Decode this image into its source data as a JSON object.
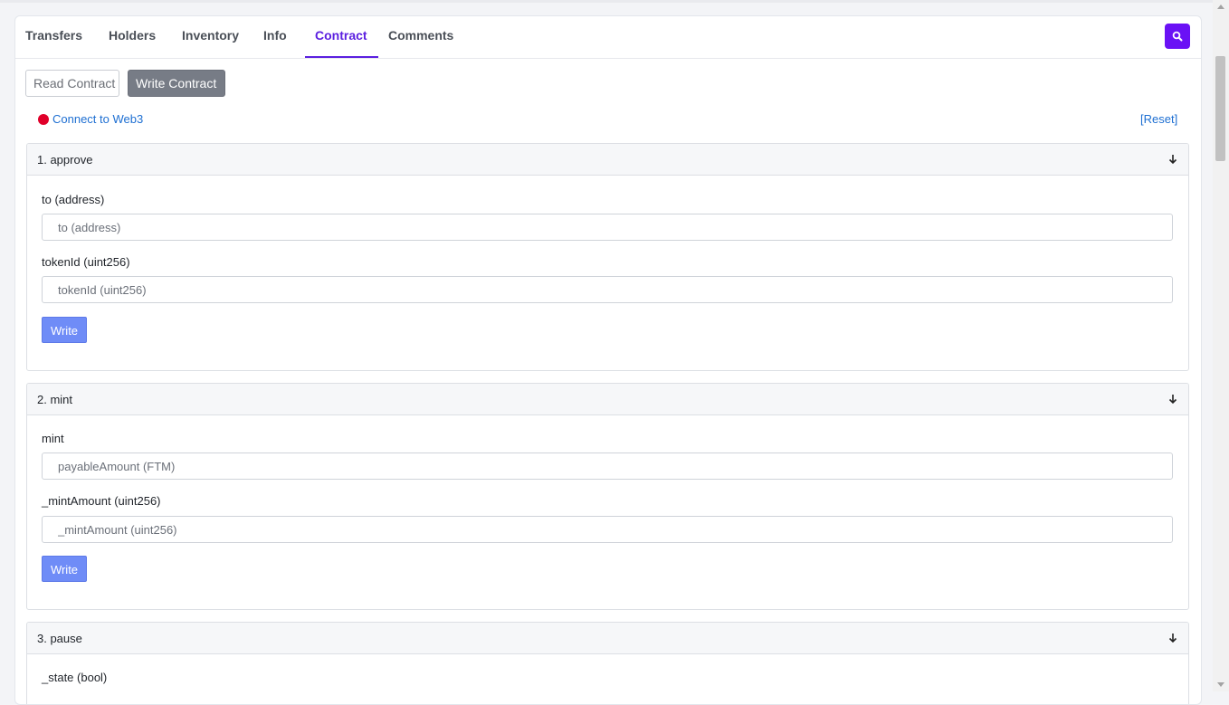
{
  "tabs": [
    {
      "label": "Transfers"
    },
    {
      "label": "Holders"
    },
    {
      "label": "Inventory"
    },
    {
      "label": "Info"
    },
    {
      "label": "Contract"
    },
    {
      "label": "Comments"
    }
  ],
  "active_tab": "Contract",
  "subtabs": {
    "read": "Read Contract",
    "write": "Write Contract",
    "active": "Write Contract"
  },
  "connect": {
    "label": "Connect to Web3",
    "status_color": "#e0002a"
  },
  "reset_label": "[Reset]",
  "sections": [
    {
      "title": "1. approve",
      "fields": [
        {
          "label": "to (address)",
          "placeholder": "to (address)"
        },
        {
          "label": "tokenId (uint256)",
          "placeholder": "tokenId (uint256)"
        }
      ],
      "button": "Write"
    },
    {
      "title": "2. mint",
      "fields": [
        {
          "label": "mint",
          "placeholder": "payableAmount (FTM)"
        },
        {
          "label": "_mintAmount (uint256)",
          "placeholder": "_mintAmount (uint256)"
        }
      ],
      "button": "Write"
    },
    {
      "title": "3. pause",
      "fields": [
        {
          "label": "_state (bool)"
        }
      ]
    }
  ],
  "colors": {
    "accent": "#5b1fe0",
    "search_button": "#6a11f5",
    "write_button": "#6f8cf7",
    "link": "#1e6fd2"
  },
  "icons": {
    "search": "search-icon",
    "expand": "arrow-down-icon",
    "status": "red-dot-icon"
  }
}
